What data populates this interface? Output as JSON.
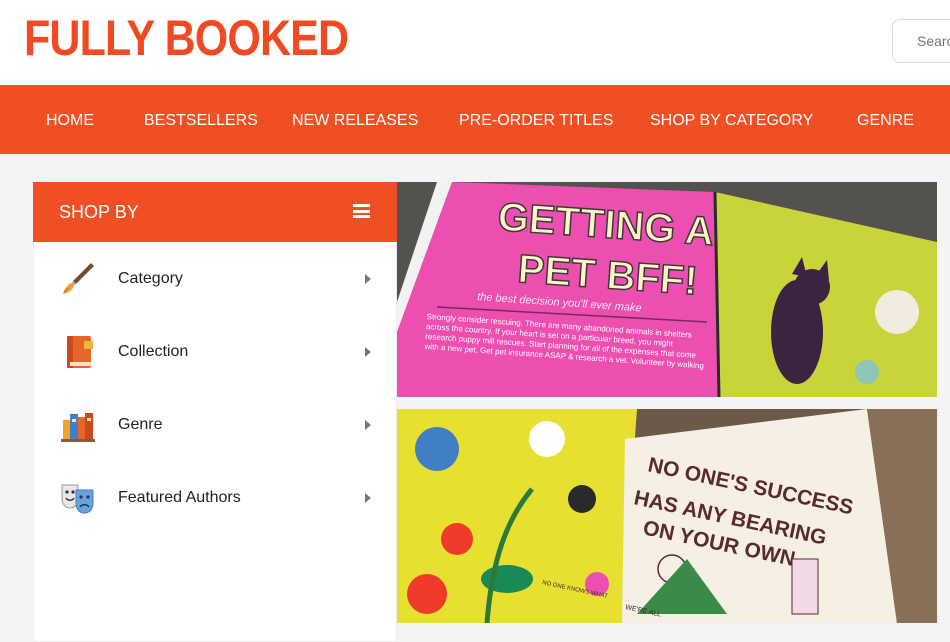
{
  "header": {
    "logo_text": "FULLY BOOKED",
    "search_placeholder": "Search"
  },
  "nav": {
    "items": [
      "HOME",
      "BESTSELLERS",
      "NEW RELEASES",
      "PRE-ORDER TITLES",
      "SHOP BY CATEGORY",
      "GENRE"
    ]
  },
  "sidebar": {
    "title": "SHOP BY",
    "menu_icon": "hamburger-icon",
    "items": [
      {
        "label": "Category",
        "icon": "paintbrush-icon"
      },
      {
        "label": "Collection",
        "icon": "book-icon"
      },
      {
        "label": "Genre",
        "icon": "books-shelf-icon"
      },
      {
        "label": "Featured Authors",
        "icon": "theater-masks-icon"
      }
    ]
  },
  "banners": [
    {
      "headline": "GETTING A PET BFF!",
      "subhead": "the best decision you'll ever make",
      "body": "Strongly consider rescuing. There are many abandoned animals in shelters across the country. If your heart is set on a particular breed, you might research puppy mill rescues. Start planning for all of the expenses that come with a new pet. Get pet insurance ASAP & research a vet. Volunteer by walking",
      "bg_color": "#ec4fb0"
    },
    {
      "headline": "NO ONE'S SUCCESS HAS ANY BEARING ON YOUR OWN",
      "body": "NO ONE KNOWS WHAT THE FUTURE HOLDS, JUST BECAUSE SOMETHING HAPPENED TO SOMEONE ELSE DOESN'T MEAN",
      "aside": "WE'RE ALL",
      "bg_color": "#e8e030"
    }
  ],
  "colors": {
    "brand": "#ef4f23",
    "logo": "#ef4a23"
  }
}
